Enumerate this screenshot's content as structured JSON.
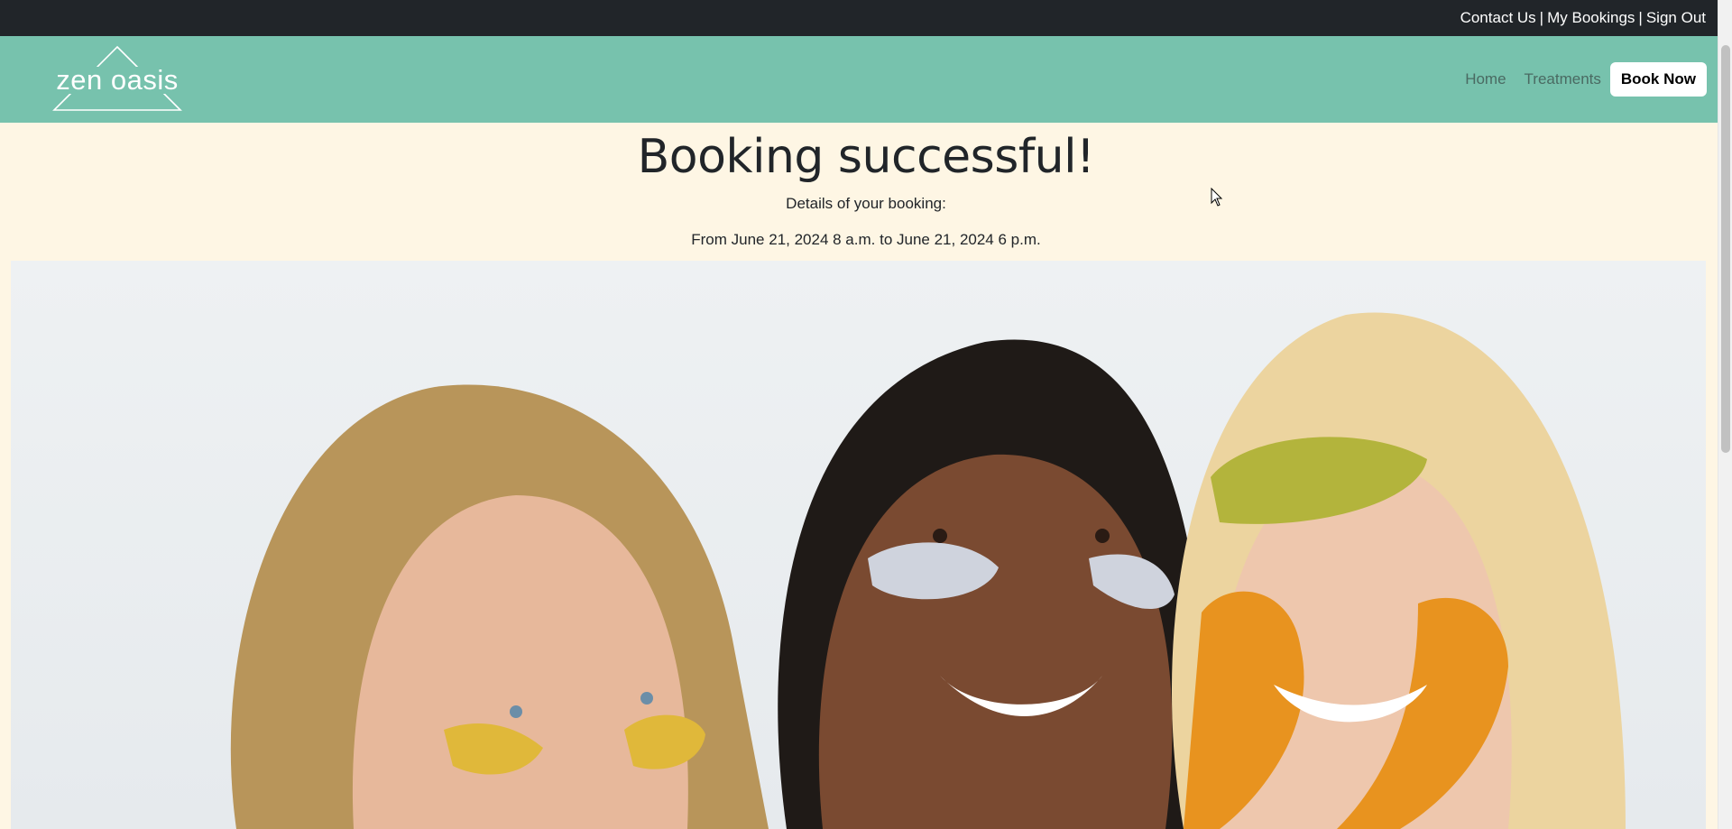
{
  "topbar": {
    "links": [
      "Contact Us",
      "My Bookings",
      "Sign Out"
    ],
    "separator": "|"
  },
  "navbar": {
    "logo_text": "zen oasis",
    "links": [
      "Home",
      "Treatments"
    ],
    "book_button": "Book Now",
    "background": "#77c2ad"
  },
  "main": {
    "title": "Booking successful!",
    "details_label": "Details of your booking:",
    "date_range": "From June 21, 2024 8 a.m. to June 21, 2024 6 p.m."
  },
  "hero": {
    "icon": "hero-photo",
    "colors": {
      "background": "#eef1f3",
      "skin_light": "#e7b89b",
      "skin_dark": "#7a4a31",
      "eye_patch_gold": "#e0b83a",
      "mask_orange": "#e8931f",
      "mask_green": "#b3b43c"
    }
  },
  "colors": {
    "page_bg": "#fef6e4",
    "topbar_bg": "#212529"
  }
}
